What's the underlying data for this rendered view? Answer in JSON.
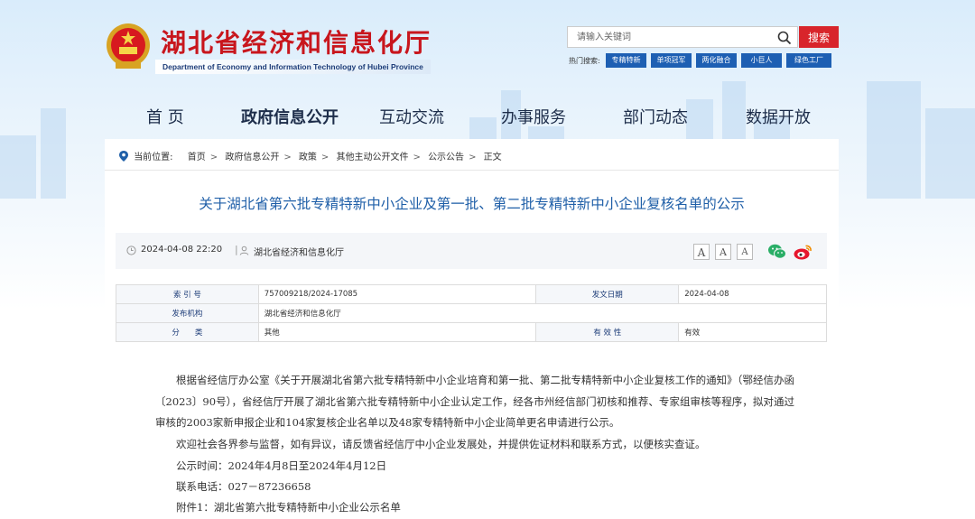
{
  "header": {
    "site_title": "湖北省经济和信息化厅",
    "site_subtitle": "Department of Economy and Information Technology of Hubei Province"
  },
  "search": {
    "placeholder": "请输入关键词",
    "button_label": "搜索",
    "hot_label": "热门搜索:",
    "hot_tags": [
      "专精特新",
      "单项冠军",
      "两化融合",
      "小巨人",
      "绿色工厂"
    ]
  },
  "nav": {
    "items": [
      "首 页",
      "政府信息公开",
      "互动交流",
      "办事服务",
      "部门动态",
      "数据开放"
    ],
    "active_index": 1
  },
  "breadcrumb": {
    "label": "当前位置:",
    "items": [
      "首页",
      "政府信息公开",
      "政策",
      "其他主动公开文件",
      "公示公告",
      "正文"
    ]
  },
  "article": {
    "title": "关于湖北省第六批专精特新中小企业及第一批、第二批专精特新中小企业复核名单的公示",
    "date": "2024-04-08 22:20",
    "divider": "|",
    "source": "湖北省经济和信息化厅",
    "font_buttons": [
      "A",
      "A",
      "A"
    ],
    "share": [
      "wechat-icon",
      "weibo-icon"
    ]
  },
  "info_table": {
    "rows": [
      {
        "k1": "索 引 号",
        "v1": "757009218/2024-17085",
        "k2": "发文日期",
        "v2": "2024-04-08"
      },
      {
        "k1": "发布机构",
        "v1": "湖北省经济和信息化厅"
      },
      {
        "k1": "分　　类",
        "v1": "其他",
        "k2": "有 效 性",
        "v2": "有效"
      }
    ]
  },
  "body": {
    "p1": "根据省经信厅办公室《关于开展湖北省第六批专精特新中小企业培育和第一批、第二批专精特新中小企业复核工作的通知》（鄂经信办函〔2023〕90号），省经信厅开展了湖北省第六批专精特新中小企业认定工作，经各市州经信部门初核和推荐、专家组审核等程序，拟对通过审核的2003家新申报企业和104家复核企业名单以及48家专精特新中小企业简单更名申请进行公示。",
    "p2": "欢迎社会各界参与监督，如有异议，请反馈省经信厅中小企业发展处，并提供佐证材料和联系方式，以便核实查证。",
    "p3": "公示时间：2024年4月8日至2024年4月12日",
    "p4": "联系电话：027－87236658",
    "p5": "附件1：湖北省第六批专精特新中小企业公示名单"
  },
  "colors": {
    "brand_red": "#c8161d",
    "link_blue": "#1f5fa8",
    "tag_blue": "#1d5fb3"
  }
}
